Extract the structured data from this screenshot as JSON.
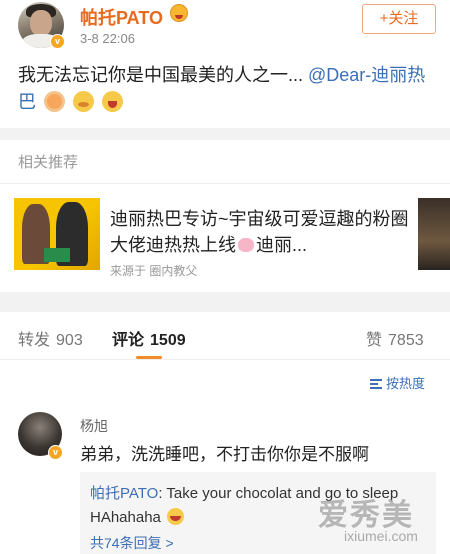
{
  "post": {
    "username": "帕托PATO",
    "timestamp": "3-8 22:06",
    "follow_label": "+关注",
    "text": "我无法忘记你是中国最美的人之一... ",
    "mention": "@Dear-迪丽热巴"
  },
  "related": {
    "section_title": "相关推荐",
    "title_part1": "迪丽热巴专访~宇宙级可爱逗趣的粉圈大佬迪热热上线",
    "title_part2": "迪丽...",
    "source": "来源于 圈内教父"
  },
  "tabs": {
    "repost_label": "转发",
    "repost_count": "903",
    "comment_label": "评论",
    "comment_count": "1509",
    "like_label": "赞",
    "like_count": "7853"
  },
  "sort_label": "按热度",
  "comment": {
    "author": "杨旭",
    "text": "弟弟，洗洗睡吧，不打击你你是不服啊",
    "reply_author": "帕托PATO",
    "reply_text": ": Take your chocolat and go to sleep HAhahaha",
    "more_replies": "共74条回复 >"
  },
  "watermark": {
    "text": "爱秀美",
    "url": "ixiumei.com"
  },
  "colors": {
    "accent_orange": "#e86a1f",
    "link_blue": "#3b6fb6",
    "verified_badge": "#f5a623"
  }
}
